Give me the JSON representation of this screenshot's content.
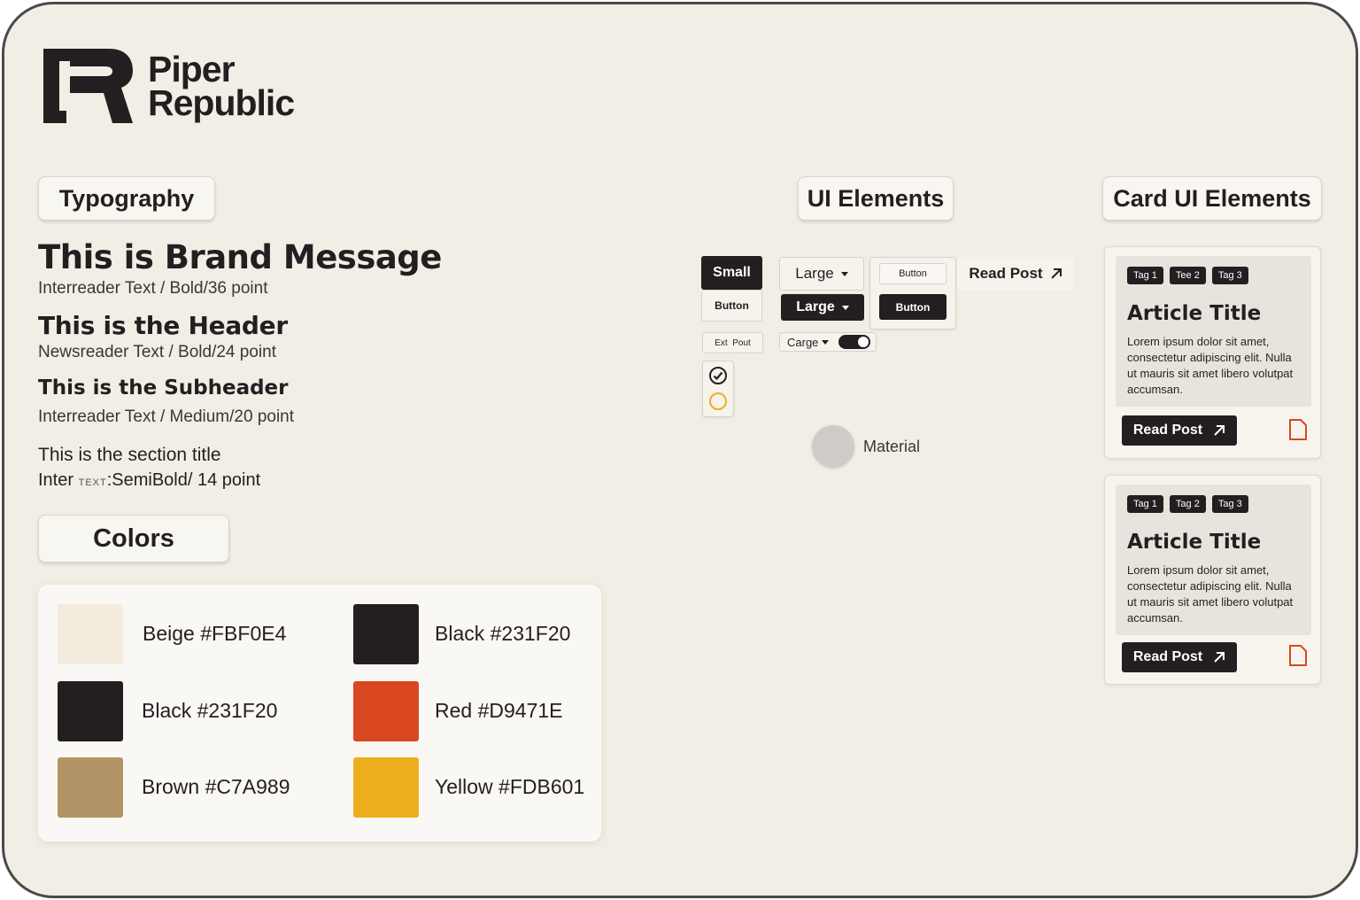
{
  "brand": {
    "line1": "Piper",
    "line2": "Republic"
  },
  "sections": {
    "typography": "Typography",
    "ui_elements": "UI Elements",
    "card_ui_elements": "Card UI Elements",
    "colors": "Colors"
  },
  "typography": {
    "brand_message": "This is Brand Message",
    "brand_caption": "Interreader Text / Bold/36 point",
    "header": "This is the Header",
    "header_caption": "Newsreader Text / Bold/24 point",
    "subheader": "This is the Subheader",
    "subheader_caption": "Interreader Text / Medium/20 point",
    "section_title": "This is the section title",
    "section_caption_prefix": "Inter",
    "section_caption_small": "TEXT",
    "section_caption_suffix": ":SemiBold/ 14 point"
  },
  "colors": [
    {
      "label": "Beige #FBF0E4",
      "hex": "#F3EBDD"
    },
    {
      "label": "Black #231F20",
      "hex": "#231F20"
    },
    {
      "label": "Black #231F20",
      "hex": "#231F20"
    },
    {
      "label": "Red #D9471E",
      "hex": "#D9471E"
    },
    {
      "label": "Brown #C7A989",
      "hex": "#B39467"
    },
    {
      "label": "Yellow #FDB601",
      "hex": "#EDAE1E"
    }
  ],
  "ui": {
    "small": "Small",
    "button": "Button",
    "large": "Large",
    "button_small": "Button",
    "read_post": "Read Post",
    "ext_pout": "Ext  Pout",
    "carge": "Carge",
    "material": "Material"
  },
  "cards": [
    {
      "tags": [
        "Tag 1",
        "Tee 2",
        "Tag 3"
      ],
      "title": "Article Title",
      "body": "Lorem ipsum dolor sit amet, consectetur adipiscing elit. Nulla ut mauris sit amet libero volutpat accumsan.",
      "button": "Read Post"
    },
    {
      "tags": [
        "Tag 1",
        "Tag 2",
        "Tag 3"
      ],
      "title": "Article Title",
      "body": "Lorem ipsum dolor sit amet, consectetur adipiscing elit. Nulla ut mauris sit amet libero volutpat accumsan.",
      "button": "Read Post"
    }
  ],
  "icons": {
    "logo": "piper-republic-logo",
    "arrow": "arrow-up-right-icon",
    "doc": "document-icon",
    "check": "check-circle-icon",
    "radio": "radio-circle-icon"
  },
  "palette": {
    "background": "#F2EEE5",
    "dark": "#231F20",
    "accent": "#D9471E",
    "yellow": "#EDAE1E"
  }
}
